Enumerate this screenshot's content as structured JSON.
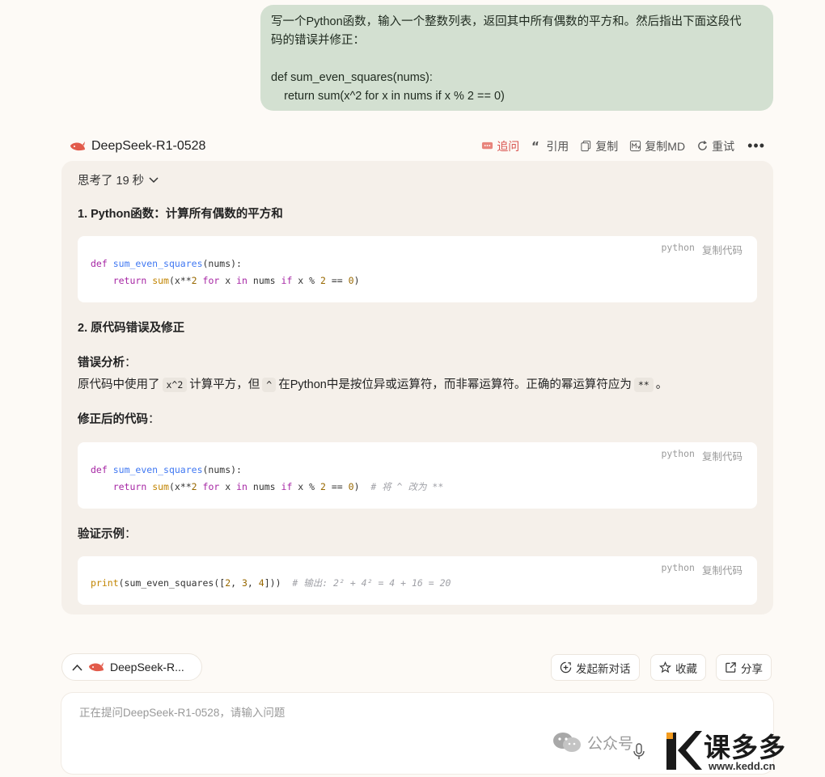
{
  "user_message": {
    "line1": "写一个Python函数，输入一个整数列表，返回其中所有偶数的平方和。然后指出下面这段代",
    "line2": "码的错误并修正：",
    "code_line1": "def sum_even_squares(nums):",
    "code_line2": "    return sum(x^2 for x in nums if x % 2 == 0)"
  },
  "model": {
    "name": "DeepSeek-R1-0528",
    "actions": {
      "followup": "追问",
      "quote": "引用",
      "copy": "复制",
      "copy_md": "复制MD",
      "retry": "重试",
      "more": "•••"
    }
  },
  "answer": {
    "thinking": "思考了 19 秒",
    "h1": "1. Python函数：计算所有偶数的平方和",
    "code1": {
      "lang": "python",
      "copy": "复制代码",
      "l1_def": "def",
      "l1_fn": "sum_even_squares",
      "l1_rest": "(nums):",
      "l2_ret": "return",
      "l2_sum": "sum",
      "l2_a": "(x**",
      "l2_n2": "2",
      "l2_for": "for",
      "l2_b": " x ",
      "l2_in": "in",
      "l2_c": " nums ",
      "l2_if": "if",
      "l2_d": " x % ",
      "l2_n2b": "2",
      "l2_e": " == ",
      "l2_n0": "0",
      "l2_f": ")"
    },
    "h2": "2. 原代码错误及修正",
    "error_title": "错误分析",
    "colon": "：",
    "error_text_1": "原代码中使用了",
    "error_code_1": "x^2",
    "error_text_2": "计算平方，但",
    "error_code_2": "^",
    "error_text_3": "在Python中是按位异或运算符，而非幂运算符。正确的幂运算符应为",
    "error_code_3": "**",
    "error_text_4": "。",
    "fixed_title": "修正后的代码",
    "code2": {
      "lang": "python",
      "copy": "复制代码",
      "comment": "# 将 ^ 改为 **"
    },
    "verify_title": "验证示例",
    "code3": {
      "lang": "python",
      "copy": "复制代码",
      "print": "print",
      "a": "(sum_even_squares([",
      "n2": "2",
      "n3": "3",
      "n4": "4",
      "b": "]))",
      "comment": "# 输出: 2² + 4² = 4 + 16 = 20"
    }
  },
  "bottom": {
    "model_pill": "DeepSeek-R...",
    "new_chat": "发起新对话",
    "favorite": "收藏",
    "share": "分享",
    "input_placeholder": "正在提问DeepSeek-R1-0528，请输入问题"
  },
  "watermark": {
    "wechat_text": "公众号",
    "brand": "课多多",
    "url": "www.kedd.cn"
  }
}
